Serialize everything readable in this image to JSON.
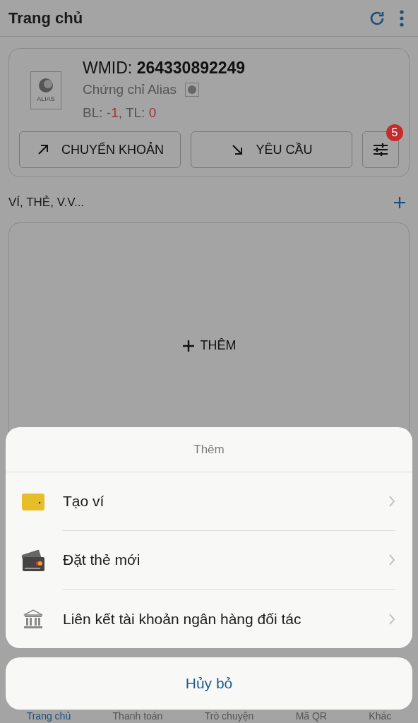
{
  "header": {
    "title": "Trang chủ"
  },
  "account": {
    "logo_text": "ALIAS",
    "wmid_label": "WMID:",
    "wmid": "264330892249",
    "certificate": "Chứng chỉ Alias",
    "balance_parts": [
      {
        "text": "BL: ",
        "kind": "label"
      },
      {
        "text": "-1",
        "kind": "value"
      },
      {
        "text": ", TL: ",
        "kind": "label"
      },
      {
        "text": "0",
        "kind": "value"
      }
    ],
    "buttons": [
      {
        "label": "CHUYỂN KHOẢN",
        "kind": "transfer"
      },
      {
        "label": "YÊU CẦU",
        "kind": "request"
      }
    ],
    "filter_badge": "5"
  },
  "section": {
    "title": "VÍ, THẺ, V.V..."
  },
  "empty_card": {
    "label": "THÊM"
  },
  "sheet": {
    "title": "Thêm",
    "items": [
      {
        "label": "Tạo ví",
        "kind": "wallet"
      },
      {
        "label": "Đặt thẻ mới",
        "kind": "card"
      },
      {
        "label": "Liên kết tài khoản ngân hàng đối tác",
        "kind": "bank"
      }
    ],
    "cancel": "Hủy bỏ"
  },
  "tabs": [
    {
      "label": "Trang chủ",
      "selected": true
    },
    {
      "label": "Thanh toán",
      "selected": false
    },
    {
      "label": "Trò chuyện",
      "selected": false
    },
    {
      "label": "Mã QR",
      "selected": false
    },
    {
      "label": "Khác",
      "selected": false
    }
  ]
}
